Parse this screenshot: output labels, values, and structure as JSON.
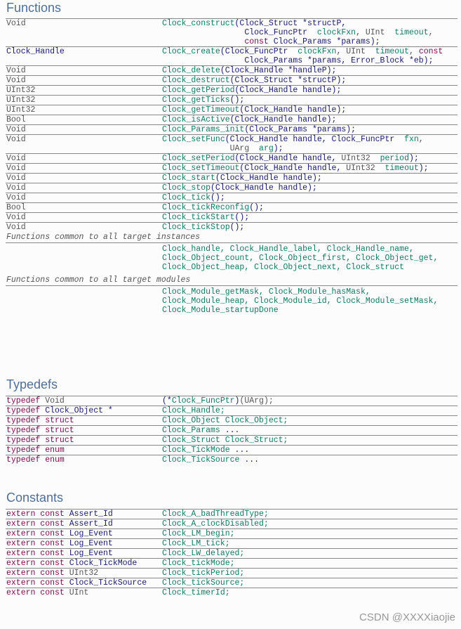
{
  "sections": {
    "functions": "Functions",
    "typedefs": "Typedefs",
    "constants": "Constants"
  },
  "functions": [
    {
      "ret": "Void",
      "lines": [
        [
          [
            "fn",
            "Clock_construct"
          ],
          [
            "d",
            "(Clock_Struct *structP,"
          ]
        ],
        [
          [
            "p",
            "                 "
          ],
          [
            "d",
            "Clock_FuncPtr  "
          ],
          [
            "a",
            "clockFxn"
          ],
          [
            "t",
            ", UInt  "
          ],
          [
            "a",
            "timeout"
          ],
          [
            "t",
            ","
          ]
        ],
        [
          [
            "p",
            "                 "
          ],
          [
            "k",
            "const "
          ],
          [
            "d",
            "Clock_Params *params);"
          ]
        ]
      ]
    },
    {
      "ret": "Clock_Handle",
      "retDark": true,
      "lines": [
        [
          [
            "fn",
            "Clock_create"
          ],
          [
            "d",
            "(Clock_FuncPtr  "
          ],
          [
            "a",
            "clockFxn"
          ],
          [
            "t",
            ", UInt  "
          ],
          [
            "a",
            "timeout"
          ],
          [
            "t",
            ", "
          ],
          [
            "k",
            "const"
          ]
        ],
        [
          [
            "p",
            "                 "
          ],
          [
            "d",
            "Clock_Params *params, Error_Block *eb);"
          ]
        ]
      ]
    },
    {
      "ret": "Void",
      "lines": [
        [
          [
            "fn",
            "Clock_delete"
          ],
          [
            "d",
            "(Clock_Handle *handleP);"
          ]
        ]
      ]
    },
    {
      "ret": "Void",
      "lines": [
        [
          [
            "fn",
            "Clock_destruct"
          ],
          [
            "d",
            "(Clock_Struct *structP);"
          ]
        ]
      ]
    },
    {
      "ret": "UInt32",
      "lines": [
        [
          [
            "fn",
            "Clock_getPeriod"
          ],
          [
            "d",
            "(Clock_Handle handle);"
          ]
        ]
      ]
    },
    {
      "ret": "UInt32",
      "lines": [
        [
          [
            "fn",
            "Clock_getTicks"
          ],
          [
            "d",
            "();"
          ]
        ]
      ]
    },
    {
      "ret": "UInt32",
      "lines": [
        [
          [
            "fn",
            "Clock_getTimeout"
          ],
          [
            "d",
            "(Clock_Handle handle);"
          ]
        ]
      ]
    },
    {
      "ret": "Bool",
      "lines": [
        [
          [
            "fn",
            "Clock_isActive"
          ],
          [
            "d",
            "(Clock_Handle handle);"
          ]
        ]
      ]
    },
    {
      "ret": "Void",
      "lines": [
        [
          [
            "fn",
            "Clock_Params_init"
          ],
          [
            "d",
            "(Clock_Params *params);"
          ]
        ]
      ]
    },
    {
      "ret": "Void",
      "lines": [
        [
          [
            "fn",
            "Clock_setFunc"
          ],
          [
            "d",
            "(Clock_Handle handle, Clock_FuncPtr  "
          ],
          [
            "a",
            "fxn"
          ],
          [
            "t",
            ","
          ]
        ],
        [
          [
            "p",
            "              "
          ],
          [
            "t",
            "UArg  "
          ],
          [
            "a",
            "arg"
          ],
          [
            "d",
            ");"
          ]
        ]
      ]
    },
    {
      "ret": "Void",
      "lines": [
        [
          [
            "fn",
            "Clock_setPeriod"
          ],
          [
            "d",
            "(Clock_Handle handle, "
          ],
          [
            "t",
            "UInt32  "
          ],
          [
            "a",
            "period"
          ],
          [
            "d",
            ");"
          ]
        ]
      ]
    },
    {
      "ret": "Void",
      "lines": [
        [
          [
            "fn",
            "Clock_setTimeout"
          ],
          [
            "d",
            "(Clock_Handle handle, "
          ],
          [
            "t",
            "UInt32  "
          ],
          [
            "a",
            "timeout"
          ],
          [
            "d",
            ");"
          ]
        ]
      ]
    },
    {
      "ret": "Void",
      "lines": [
        [
          [
            "fn",
            "Clock_start"
          ],
          [
            "d",
            "(Clock_Handle handle);"
          ]
        ]
      ]
    },
    {
      "ret": "Void",
      "lines": [
        [
          [
            "fn",
            "Clock_stop"
          ],
          [
            "d",
            "(Clock_Handle handle);"
          ]
        ]
      ]
    },
    {
      "ret": "Void",
      "lines": [
        [
          [
            "fn",
            "Clock_tick"
          ],
          [
            "d",
            "();"
          ]
        ]
      ]
    },
    {
      "ret": "Bool",
      "lines": [
        [
          [
            "fn",
            "Clock_tickReconfig"
          ],
          [
            "d",
            "();"
          ]
        ]
      ]
    },
    {
      "ret": "Void",
      "lines": [
        [
          [
            "fn",
            "Clock_tickStart"
          ],
          [
            "d",
            "();"
          ]
        ]
      ]
    },
    {
      "ret": "Void",
      "lines": [
        [
          [
            "fn",
            "Clock_tickStop"
          ],
          [
            "d",
            "();"
          ]
        ]
      ]
    }
  ],
  "groups": [
    {
      "title": "Functions common to all target instances",
      "lines": [
        "Clock_handle, Clock_Handle_label, Clock_Handle_name,",
        "Clock_Object_count, Clock_Object_first, Clock_Object_get,",
        "Clock_Object_heap, Clock_Object_next, Clock_struct"
      ]
    },
    {
      "title": "Functions common to all target modules",
      "lines": [
        "Clock_Module_getMask, Clock_Module_hasMask,",
        "Clock_Module_heap, Clock_Module_id, Clock_Module_setMask,",
        "Clock_Module_startupDone"
      ]
    }
  ],
  "typedefs": [
    {
      "kw": "typedef",
      "type": "Void",
      "typeStyle": "t",
      "rhs": [
        [
          "d",
          "(*"
        ],
        [
          "fn",
          "Clock_FuncPtr"
        ],
        [
          "d",
          ")"
        ],
        [
          "t",
          "(UArg);"
        ]
      ]
    },
    {
      "kw": "typedef",
      "type": "Clock_Object *",
      "typeStyle": "d",
      "rhs": [
        [
          "fn",
          "Clock_Handle;"
        ]
      ]
    },
    {
      "kw": "typedef",
      "type": "struct",
      "typeStyle": "k",
      "rhs": [
        [
          "fn",
          "Clock_Object Clock_Object;"
        ]
      ]
    },
    {
      "kw": "typedef",
      "type": "struct",
      "typeStyle": "k",
      "rhs": [
        [
          "fn",
          "Clock_Params"
        ],
        [
          "d",
          " ..."
        ]
      ]
    },
    {
      "kw": "typedef",
      "type": "struct",
      "typeStyle": "k",
      "rhs": [
        [
          "fn",
          "Clock_Struct Clock_Struct;"
        ]
      ]
    },
    {
      "kw": "typedef",
      "type": "enum",
      "typeStyle": "k",
      "rhs": [
        [
          "fn",
          "Clock_TickMode"
        ],
        [
          "d",
          " ..."
        ]
      ]
    },
    {
      "kw": "typedef",
      "type": "enum",
      "typeStyle": "k",
      "rhs": [
        [
          "fn",
          "Clock_TickSource"
        ],
        [
          "d",
          " ..."
        ]
      ]
    }
  ],
  "constants": [
    {
      "kw": "extern const",
      "type": "Assert_Id",
      "typeStyle": "d",
      "name": "Clock_A_badThreadType;"
    },
    {
      "kw": "extern const",
      "type": "Assert_Id",
      "typeStyle": "d",
      "name": "Clock_A_clockDisabled;"
    },
    {
      "kw": "extern const",
      "type": "Log_Event",
      "typeStyle": "d",
      "name": "Clock_LM_begin;"
    },
    {
      "kw": "extern const",
      "type": "Log_Event",
      "typeStyle": "d",
      "name": "Clock_LM_tick;"
    },
    {
      "kw": "extern const",
      "type": "Log_Event",
      "typeStyle": "d",
      "name": "Clock_LW_delayed;"
    },
    {
      "kw": "extern const",
      "type": "Clock_TickMode",
      "typeStyle": "d",
      "name": "Clock_tickMode;"
    },
    {
      "kw": "extern const",
      "type": "UInt32",
      "typeStyle": "t",
      "name": "Clock_tickPeriod;"
    },
    {
      "kw": "extern const",
      "type": "Clock_TickSource",
      "typeStyle": "d",
      "name": "Clock_tickSource;"
    },
    {
      "kw": "extern const",
      "type": "UInt",
      "typeStyle": "t",
      "name": "Clock_timerId;"
    }
  ],
  "watermark": "CSDN @XXXXiaojie",
  "colors": {
    "heading": "#4f6f96",
    "function": "#117a63",
    "keyword": "#7a0a4e",
    "type": "#1a1a6e"
  }
}
